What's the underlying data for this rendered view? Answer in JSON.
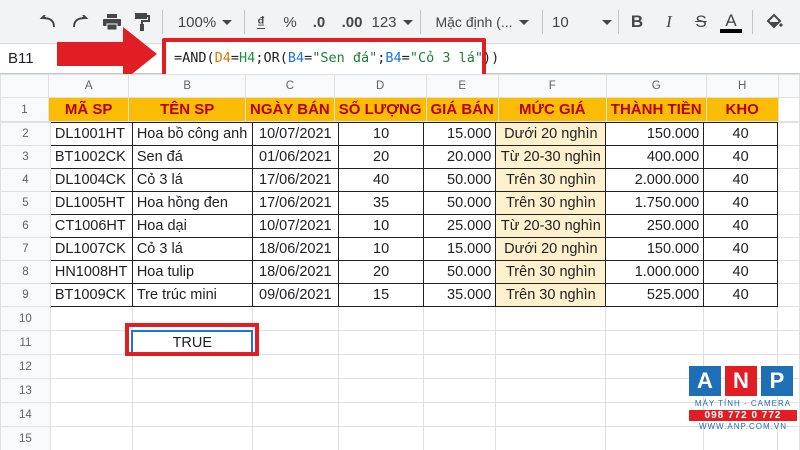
{
  "toolbar": {
    "zoom": "100%",
    "currency": "₫",
    "percent": "%",
    "dec_decrease": ".0",
    "dec_increase": ".00",
    "more_formats": "123",
    "font": "Mặc định (...",
    "font_size": "10",
    "bold": "B",
    "italic": "I",
    "strike": "S",
    "text_color": "A"
  },
  "formula_bar": {
    "cell_ref": "B11",
    "formula_parts": [
      {
        "text": "=AND(",
        "color": "#202124"
      },
      {
        "text": "D4",
        "color": "#e37400"
      },
      {
        "text": "=",
        "color": "#202124"
      },
      {
        "text": "H4",
        "color": "#1e8e3e"
      },
      {
        "text": ";OR(",
        "color": "#202124"
      },
      {
        "text": "B4",
        "color": "#1a73e8"
      },
      {
        "text": "=",
        "color": "#202124"
      },
      {
        "text": "\"Sen đá\"",
        "color": "#188038"
      },
      {
        "text": ";",
        "color": "#202124"
      },
      {
        "text": "B4",
        "color": "#1a73e8"
      },
      {
        "text": "=",
        "color": "#202124"
      },
      {
        "text": "\"Cỏ 3 lá\"",
        "color": "#188038"
      },
      {
        "text": "))",
        "color": "#202124"
      }
    ]
  },
  "columns": [
    "A",
    "B",
    "C",
    "D",
    "E",
    "F",
    "G",
    "H"
  ],
  "headers": [
    "MÃ SP",
    "TÊN SP",
    "NGÀY BÁN",
    "SỐ LƯỢNG",
    "GIÁ BÁN",
    "MỨC GIÁ",
    "THÀNH TIỀN",
    "KHO"
  ],
  "rows": [
    [
      "DL1001HT",
      "Hoa bồ công anh",
      "10/07/2021",
      "10",
      "15.000",
      "Dưới 20 nghìn",
      "150.000",
      "40"
    ],
    [
      "BT1002CK",
      "Sen đá",
      "01/06/2021",
      "20",
      "20.000",
      "Từ 20-30 nghìn",
      "400.000",
      "40"
    ],
    [
      "DL1004CK",
      "Cỏ 3 lá",
      "17/06/2021",
      "40",
      "50.000",
      "Trên 30 nghìn",
      "2.000.000",
      "40"
    ],
    [
      "DL1005HT",
      "Hoa hồng đen",
      "17/06/2021",
      "35",
      "50.000",
      "Trên 30 nghìn",
      "1.750.000",
      "40"
    ],
    [
      "CT1006HT",
      "Hoa dại",
      "10/07/2021",
      "10",
      "25.000",
      "Từ 20-30 nghìn",
      "250.000",
      "40"
    ],
    [
      "DL1007CK",
      "Cỏ 3 lá",
      "18/06/2021",
      "10",
      "15.000",
      "Dưới 20 nghìn",
      "150.000",
      "40"
    ],
    [
      "HN1008HT",
      "Hoa tulip",
      "18/06/2021",
      "20",
      "50.000",
      "Trên 30 nghìn",
      "1.000.000",
      "40"
    ],
    [
      "BT1009CK",
      "Tre trúc mini",
      "09/06/2021",
      "15",
      "35.000",
      "Trên 30 nghìn",
      "525.000",
      "40"
    ]
  ],
  "row_numbers": [
    "1",
    "2",
    "3",
    "4",
    "5",
    "6",
    "7",
    "8",
    "9",
    "10",
    "11",
    "12",
    "13",
    "14",
    "15"
  ],
  "result_cell": {
    "ref": "B11",
    "value": "TRUE"
  },
  "logo": {
    "letters": [
      "A",
      "N",
      "P"
    ],
    "tagline": "MÁY TÍNH - CAMERA",
    "phone": "098 772 0 772",
    "website": "WWW.ANP.COM.VN"
  },
  "colors": {
    "header_fill": "#fbbc04",
    "header_text": "#b80000",
    "price_level_fill": "#fdf0cc",
    "highlight_red": "#e01e24",
    "selection_blue": "#1a73e8"
  }
}
